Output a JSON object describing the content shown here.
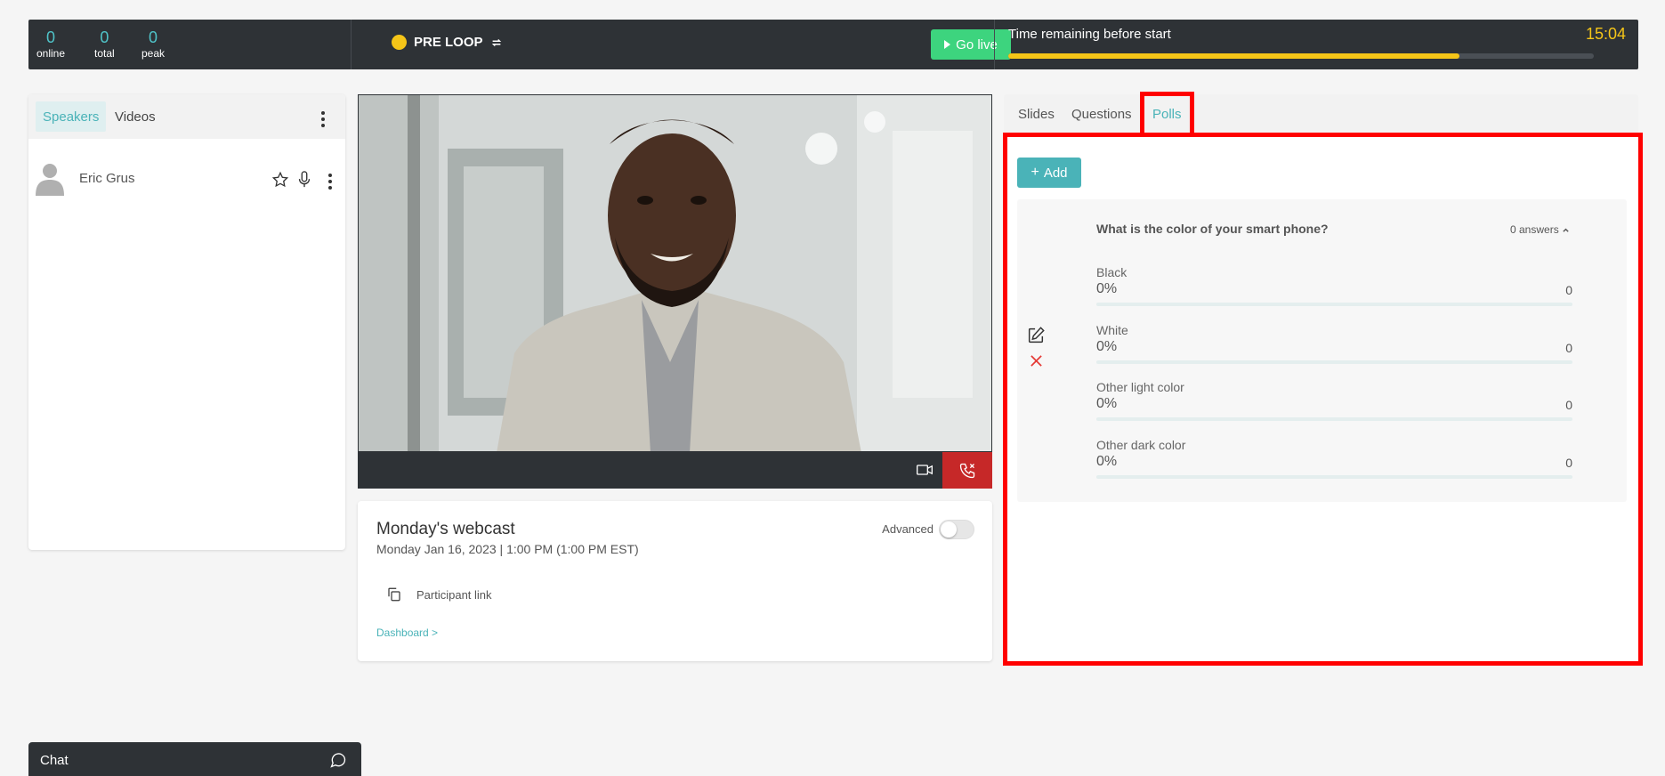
{
  "stats": [
    {
      "value": "0",
      "label": "online"
    },
    {
      "value": "0",
      "label": "total"
    },
    {
      "value": "0",
      "label": "peak"
    }
  ],
  "status": {
    "label": "PRE LOOP",
    "color": "#f5c518"
  },
  "go_live_label": "Go live",
  "timer": {
    "label": "Time remaining before start",
    "value": "15:04",
    "progress": 0.77
  },
  "left_panel": {
    "tabs": [
      "Speakers",
      "Videos"
    ],
    "active_tab": "Speakers",
    "speakers": [
      {
        "name": "Eric Grus"
      }
    ]
  },
  "webcast": {
    "title": "Monday's webcast",
    "date": "Monday Jan 16, 2023 | 1:00 PM (1:00 PM EST)",
    "advanced_label": "Advanced",
    "advanced_on": false,
    "participant_link_label": "Participant link",
    "dashboard_link": "Dashboard >"
  },
  "right_panel": {
    "tabs": [
      "Slides",
      "Questions",
      "Polls"
    ],
    "active_tab": "Polls",
    "add_label": "Add",
    "poll": {
      "question": "What is the color of your smart phone?",
      "answers_count": "0 answers",
      "options": [
        {
          "label": "Black",
          "percent": "0%",
          "count": "0"
        },
        {
          "label": "White",
          "percent": "0%",
          "count": "0"
        },
        {
          "label": "Other light color",
          "percent": "0%",
          "count": "0"
        },
        {
          "label": "Other dark color",
          "percent": "0%",
          "count": "0"
        }
      ]
    }
  },
  "chat_label": "Chat",
  "colors": {
    "accent": "#4ab3b8",
    "go_live": "#3dd47e",
    "danger": "#c62828",
    "highlight": "#ff0000",
    "bar": "#2e3236"
  }
}
